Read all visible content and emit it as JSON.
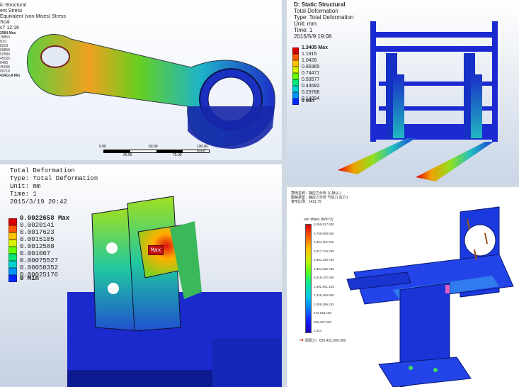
{
  "panel1": {
    "info": [
      "ic Structural",
      "ent Stress",
      "Equivalent (von-Mises) Stress",
      "Scal",
      "c7 12:16"
    ],
    "legend": [
      "2584 Max",
      "78853",
      "81/1",
      "8219",
      "69858",
      "52584",
      "45165",
      "6493",
      "45165",
      "09718",
      "4341e-8 Min"
    ],
    "scale_top": [
      "0.00",
      "50.00",
      "100.00 (mm)"
    ],
    "scale_bottom": [
      "25.00",
      "75.00"
    ]
  },
  "panel2": {
    "info": [
      "D: Static Structural",
      "Total Deformation",
      "Type: Total Deformation",
      "Unit: mm",
      "Time: 1",
      "2015/5/9 19:08"
    ],
    "legend": [
      "1.3405 Max",
      "1.1915",
      "1.0426",
      "0.89365",
      "0.74471",
      "0.59577",
      "0.44682",
      "0.29788",
      "0.14894",
      "0 Min"
    ]
  },
  "panel3": {
    "info": [
      "Total Deformation",
      "Type: Total Deformation",
      "Unit: mm",
      "Time: 1",
      "2015/3/19 20:42"
    ],
    "legend": [
      "0.0022658 Max",
      "0.0020141",
      "0.0017623",
      "0.0015105",
      "0.0012588",
      "0.001007",
      "0.00075527",
      "0.00050352",
      "0.00025176",
      "0 Min"
    ],
    "probe": "Max"
  },
  "panel4": {
    "info": [
      "算例名称：静应力分析 1(-默认-)",
      "图解类型：静应力分析 节应力 应力1",
      "变形比例：1431.75"
    ],
    "legend_title": "von Mises (N/m^2)",
    "legend": [
      "4,095,917.500",
      "3,759,558.500",
      "3,364,119.750",
      "3,027,724.750",
      "2,691,330.750",
      "2,354,932.750",
      "2,018,472.000",
      "1,682,801.125",
      "1,346,494.500",
      "1,009,399.125",
      "672,928.188",
      "336,457.250",
      "2.224"
    ],
    "yield": "屈服力：620,422,000.000"
  },
  "colors": [
    "#d80000",
    "#ff5a00",
    "#ffc000",
    "#d8f000",
    "#64ff00",
    "#00e678",
    "#00d2d2",
    "#0096ff",
    "#0028ff",
    "#1e00c8"
  ]
}
